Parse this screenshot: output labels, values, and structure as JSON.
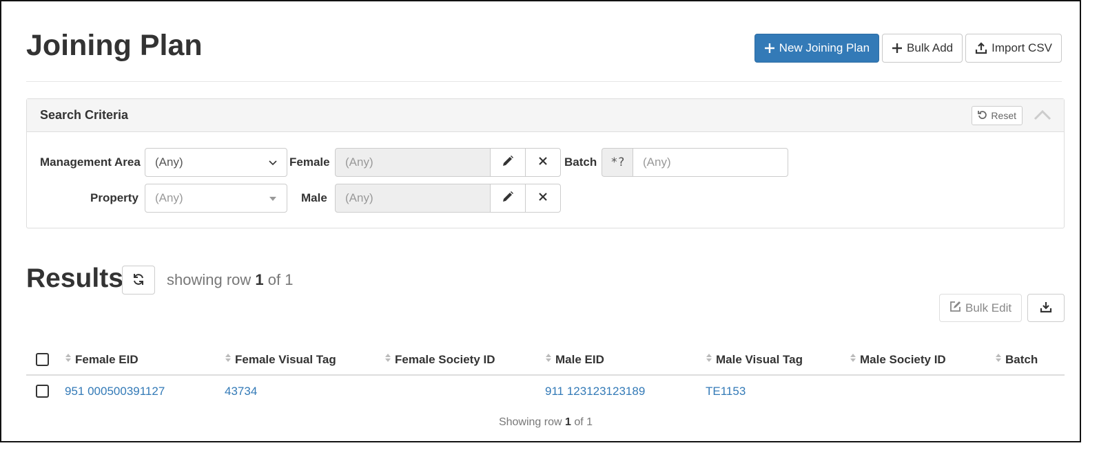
{
  "header": {
    "title": "Joining Plan",
    "new_button": "New Joining Plan",
    "bulk_add_button": "Bulk Add",
    "import_button": "Import CSV"
  },
  "search": {
    "title": "Search Criteria",
    "reset": "Reset",
    "management_area": {
      "label": "Management Area",
      "value": "(Any)"
    },
    "property": {
      "label": "Property",
      "value": "(Any)"
    },
    "female": {
      "label": "Female",
      "value": "(Any)"
    },
    "male": {
      "label": "Male",
      "value": "(Any)"
    },
    "batch": {
      "label": "Batch",
      "addon": "*?",
      "placeholder": "(Any)"
    }
  },
  "results": {
    "title": "Results",
    "showing_prefix": "showing row ",
    "showing_row": "1",
    "showing_of": " of 1",
    "bulk_edit": "Bulk Edit",
    "columns": [
      "Female EID",
      "Female Visual Tag",
      "Female Society ID",
      "Male EID",
      "Male Visual Tag",
      "Male Society ID",
      "Batch"
    ],
    "rows": [
      {
        "female_eid": "951 000500391127",
        "female_visual_tag": "43734",
        "female_society_id": "",
        "male_eid": "911 123123123189",
        "male_visual_tag": "TE1153",
        "male_society_id": "",
        "batch": ""
      }
    ],
    "footer_prefix": "Showing row ",
    "footer_row": "1",
    "footer_of": " of 1"
  },
  "colors": {
    "primary": "#337ab7",
    "link": "#337ab7",
    "panel_header": "#f5f5f5",
    "muted": "#777777"
  },
  "icons": [
    "plus-icon",
    "upload-icon",
    "undo-icon",
    "chevron-up-icon",
    "chevron-down-icon",
    "caret-down-icon",
    "pencil-icon",
    "close-icon",
    "refresh-icon",
    "edit-icon",
    "download-icon",
    "sort-icon"
  ]
}
